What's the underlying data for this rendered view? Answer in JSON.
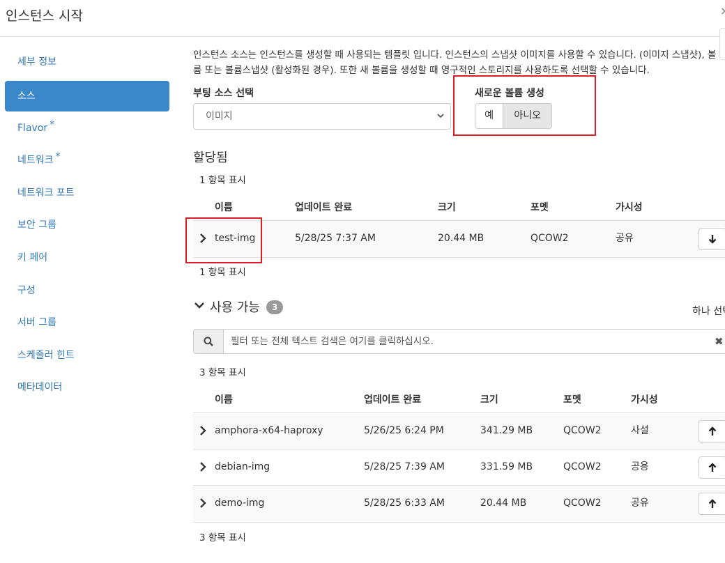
{
  "header": {
    "title": "인스턴스 시작",
    "close": "×"
  },
  "sidebar": {
    "items": [
      {
        "label": "세부 정보",
        "required": false
      },
      {
        "label": "소스",
        "required": false,
        "active": true
      },
      {
        "label": "Flavor",
        "required": true
      },
      {
        "label": "네트워크",
        "required": true
      },
      {
        "label": "네트워크 포트",
        "required": false
      },
      {
        "label": "보안 그룹",
        "required": false
      },
      {
        "label": "키 페어",
        "required": false
      },
      {
        "label": "구성",
        "required": false
      },
      {
        "label": "서버 그룹",
        "required": false
      },
      {
        "label": "스케줄러 힌트",
        "required": false
      },
      {
        "label": "메타데이터",
        "required": false
      }
    ],
    "required_marker": "*"
  },
  "source": {
    "description": "인스턴스 소스는 인스턴스를 생성할 때 사용되는 템플릿 입니다. 인스턴스의 스냅샷 이미지를 사용할 수 있습니다. (이미지 스냅샷), 볼륨 또는 볼륨스냅샷 (활성화된 경우). 또한 새 볼륨을 생성할 때 영구적인 스토리지를 사용하도록 선택할 수 있습니다.",
    "boot_source_label": "부팅 소스 선택",
    "boot_source_value": "이미지",
    "new_volume_label": "새로운 볼륨 생성",
    "new_volume_yes": "예",
    "new_volume_no": "아니오",
    "new_volume_selected": "아니오"
  },
  "allocated": {
    "title": "할당됨",
    "count_top": "1 항목 표시",
    "count_bottom": "1 항목 표시",
    "columns": [
      "이름",
      "업데이트 완료",
      "크기",
      "포멧",
      "가시성"
    ],
    "rows": [
      {
        "name": "test-img",
        "updated": "5/28/25 7:37 AM",
        "size": "20.44 MB",
        "format": "QCOW2",
        "visibility": "공유"
      }
    ]
  },
  "available": {
    "title": "사용 가능",
    "badge": "3",
    "select_one": "하나 선택",
    "search_placeholder": "필터 또는 전체 텍스트 검색은 여기를 클릭하십시오.",
    "count_top": "3 항목 표시",
    "count_bottom": "3 항목 표시",
    "columns": [
      "이름",
      "업데이트 완료",
      "크기",
      "포멧",
      "가시성"
    ],
    "rows": [
      {
        "name": "amphora-x64-haproxy",
        "updated": "5/26/25 6:24 PM",
        "size": "341.29 MB",
        "format": "QCOW2",
        "visibility": "사설"
      },
      {
        "name": "debian-img",
        "updated": "5/28/25 7:39 AM",
        "size": "331.59 MB",
        "format": "QCOW2",
        "visibility": "공용"
      },
      {
        "name": "demo-img",
        "updated": "5/28/25 6:33 AM",
        "size": "20.44 MB",
        "format": "QCOW2",
        "visibility": "공유"
      }
    ]
  },
  "colors": {
    "accent": "#3a87c9",
    "link": "#337ab7",
    "highlight": "#dd1c24"
  },
  "icons": {
    "expander": "chevron-right-icon",
    "deallocate": "arrow-down-icon",
    "allocate": "arrow-up-icon",
    "search": "search-icon",
    "clear": "times-icon",
    "collapse": "chevron-down-icon"
  }
}
